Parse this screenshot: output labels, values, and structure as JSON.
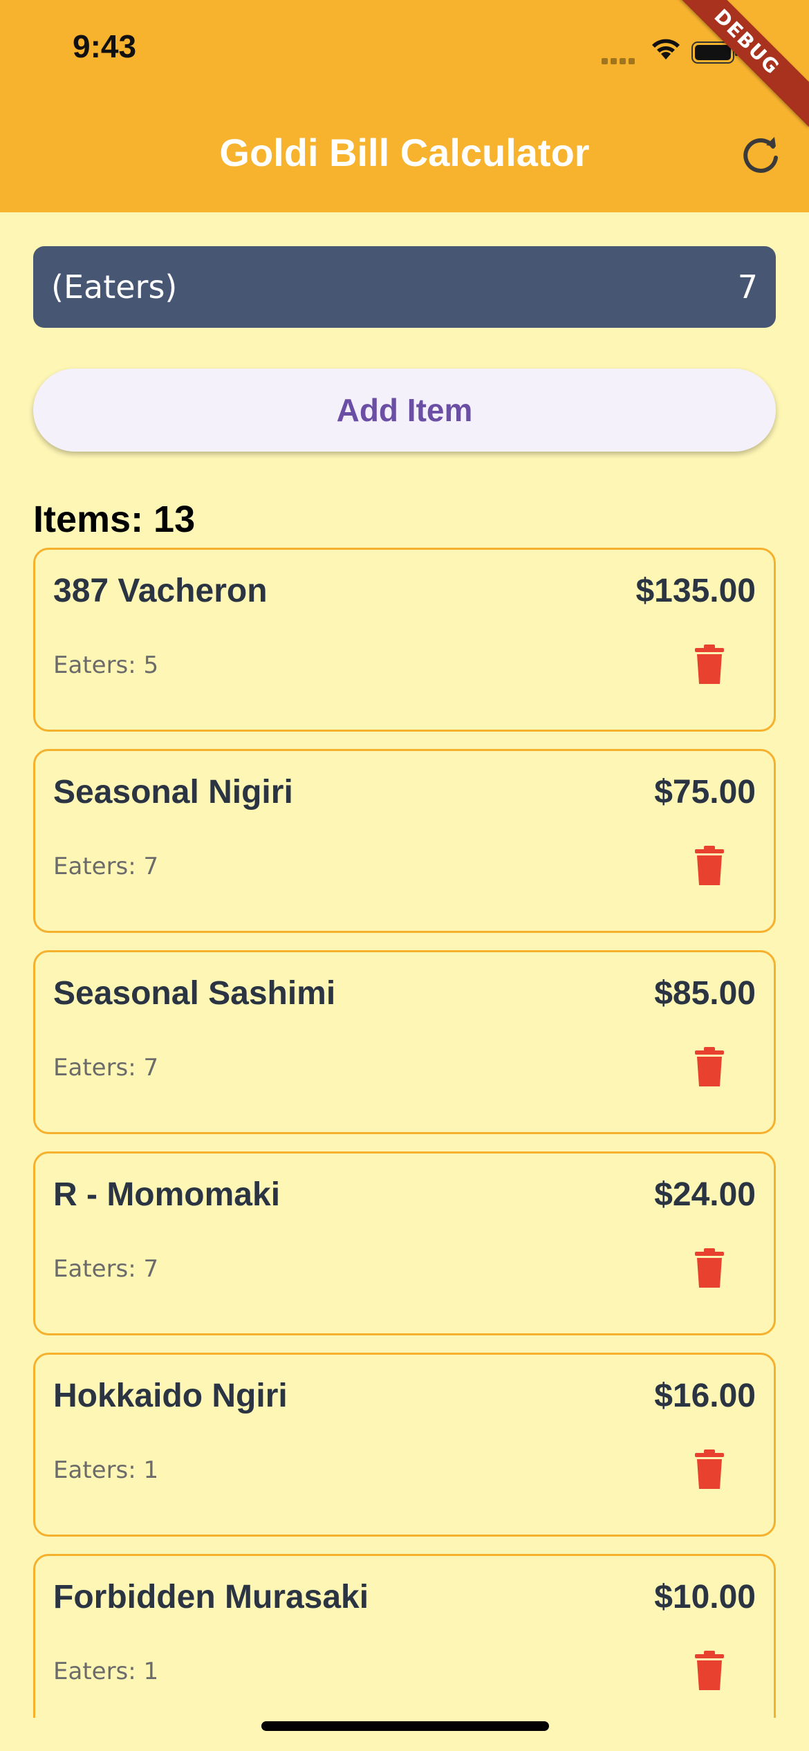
{
  "status_bar": {
    "time": "9:43"
  },
  "app_bar": {
    "title": "Goldi Bill Calculator",
    "refresh_icon": "refresh-icon",
    "debug_banner": "DEBUG"
  },
  "eaters": {
    "label": "(Eaters)",
    "value": "7"
  },
  "add_item": {
    "label": "Add Item"
  },
  "items_header": "Items: 13",
  "items": [
    {
      "name": "387 Vacheron",
      "price": "$135.00",
      "eaters": "Eaters: 5"
    },
    {
      "name": "Seasonal Nigiri",
      "price": "$75.00",
      "eaters": "Eaters: 7"
    },
    {
      "name": "Seasonal Sashimi",
      "price": "$85.00",
      "eaters": "Eaters: 7"
    },
    {
      "name": "R - Momomaki",
      "price": "$24.00",
      "eaters": "Eaters: 7"
    },
    {
      "name": "Hokkaido Ngiri",
      "price": "$16.00",
      "eaters": "Eaters: 1"
    },
    {
      "name": "Forbidden Murasaki",
      "price": "$10.00",
      "eaters": "Eaters: 1"
    }
  ],
  "colors": {
    "app_bar": "#f7b32e",
    "background": "#fef6b4",
    "eaters_bar": "#475773",
    "card_border": "#f5b02e",
    "delete": "#e8412f",
    "add_item_text": "#6a4fa4"
  }
}
